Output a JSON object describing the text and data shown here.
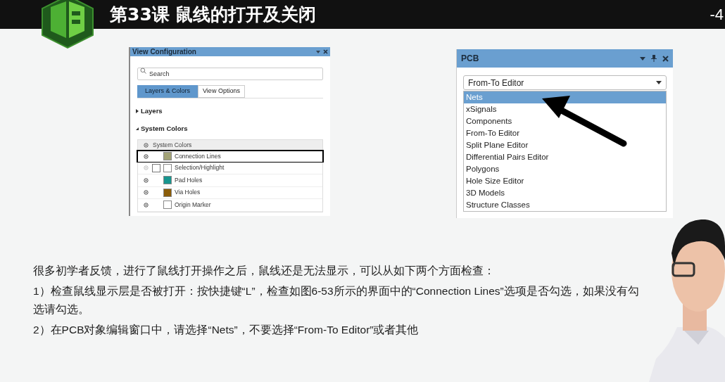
{
  "header": {
    "title": "第33课 鼠线的打开及关闭",
    "page": "-4"
  },
  "view_config": {
    "title": "View Configuration",
    "search": {
      "placeholder": "Search"
    },
    "tabs": [
      {
        "label": "Layers & Colors",
        "selected": true
      },
      {
        "label": "View Options",
        "selected": false
      }
    ],
    "sections": [
      {
        "label": "Layers",
        "expanded": false
      },
      {
        "label": "System Colors",
        "expanded": true
      }
    ],
    "list_header": "System Colors",
    "rows": [
      {
        "label": "Connection Lines",
        "kind": "swatch",
        "visible": true,
        "outlined": true,
        "color": "#a3a377"
      },
      {
        "label": "Selection/Highlight",
        "kind": "checkbox",
        "visible": false,
        "outlined": false,
        "color": "#ffffff"
      },
      {
        "label": "Pad Holes",
        "kind": "swatch",
        "visible": true,
        "outlined": false,
        "color": "#17958f"
      },
      {
        "label": "Via Holes",
        "kind": "swatch",
        "visible": true,
        "outlined": false,
        "color": "#8a5c08"
      },
      {
        "label": "Origin Marker",
        "kind": "swatch",
        "visible": true,
        "outlined": false,
        "color": "#ffffff"
      }
    ]
  },
  "pcb": {
    "title": "PCB",
    "dropdown": {
      "value": "From-To Editor"
    },
    "options": [
      {
        "label": "Nets",
        "selected": true
      },
      {
        "label": "xSignals",
        "selected": false
      },
      {
        "label": "Components",
        "selected": false
      },
      {
        "label": "From-To Editor",
        "selected": false
      },
      {
        "label": "Split Plane Editor",
        "selected": false
      },
      {
        "label": "Differential Pairs Editor",
        "selected": false
      },
      {
        "label": "Polygons",
        "selected": false
      },
      {
        "label": "Hole Size Editor",
        "selected": false
      },
      {
        "label": "3D Models",
        "selected": false
      },
      {
        "label": "Structure Classes",
        "selected": false
      }
    ]
  },
  "notes": [
    "很多初学者反馈，进行了鼠线打开操作之后，鼠线还是无法显示，可以从如下两个方面检查：",
    "1）检查鼠线显示层是否被打开：按快捷键“L”，检查如图6-53所示的界面中的“Connection Lines”选项是否勾选，如果没有勾选请勾选。",
    "2）在PCB对象编辑窗口中，请选择“Nets”，不要选择“From-To Editor”或者其他"
  ]
}
